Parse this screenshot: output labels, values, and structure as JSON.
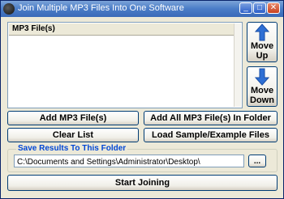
{
  "window": {
    "title": "Join Multiple MP3 Files Into One Software",
    "minimize_glyph": "_",
    "maximize_glyph": "□",
    "close_glyph": "✕"
  },
  "list": {
    "header": "MP3 File(s)"
  },
  "move": {
    "up_line1": "Move",
    "up_line2": "Up",
    "down_line1": "Move",
    "down_line2": "Down",
    "arrow_color": "#2e6fd4"
  },
  "buttons": {
    "add_files": "Add MP3 File(s)",
    "add_all_in_folder": "Add All MP3 File(s) In Folder",
    "clear_list": "Clear List",
    "load_samples": "Load Sample/Example Files",
    "start_joining": "Start Joining",
    "browse": "..."
  },
  "save": {
    "label": "Save Results To This Folder",
    "path": "C:\\Documents and Settings\\Administrator\\Desktop\\"
  }
}
